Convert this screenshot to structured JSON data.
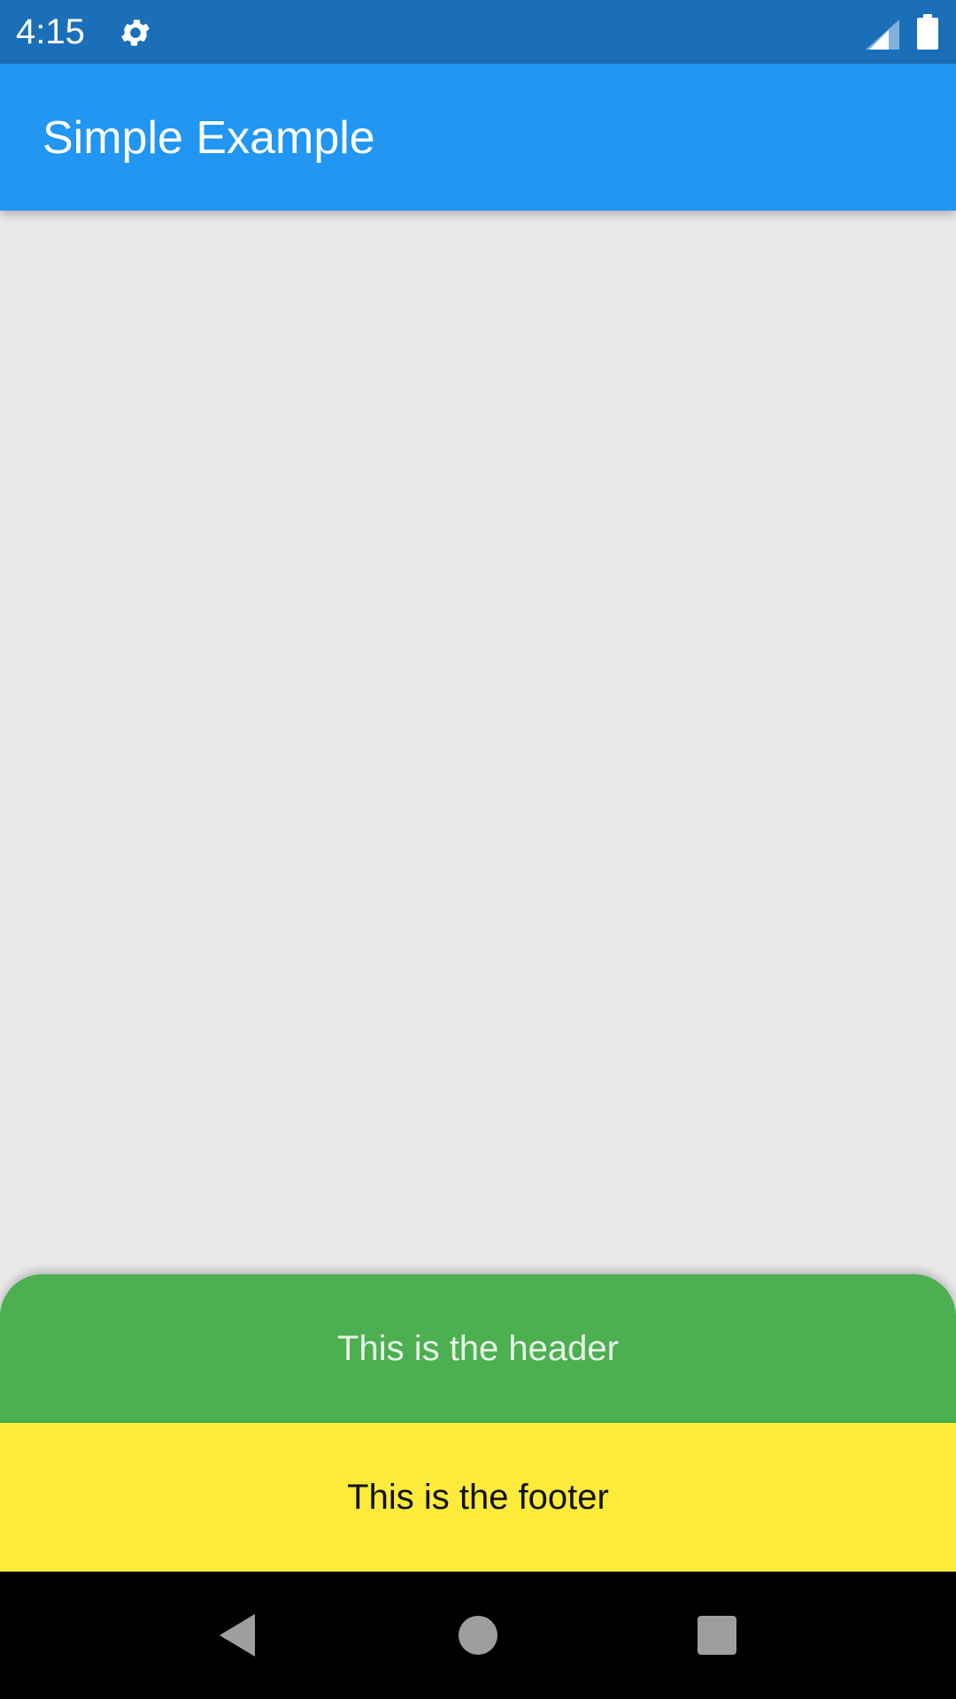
{
  "status_bar": {
    "time": "4:15",
    "icons": [
      "gear-icon",
      "signal-icon",
      "battery-icon"
    ],
    "background": "#1b6fb8"
  },
  "app_bar": {
    "title": "Simple Example",
    "background": "#2196f3"
  },
  "bottom_sheet": {
    "header_text": "This is the header",
    "header_color": "#4caf50",
    "footer_text": "This is the footer",
    "footer_color": "#ffeb3b"
  },
  "navigation_bar": {
    "buttons": [
      "back-icon",
      "home-icon",
      "recents-icon"
    ]
  }
}
